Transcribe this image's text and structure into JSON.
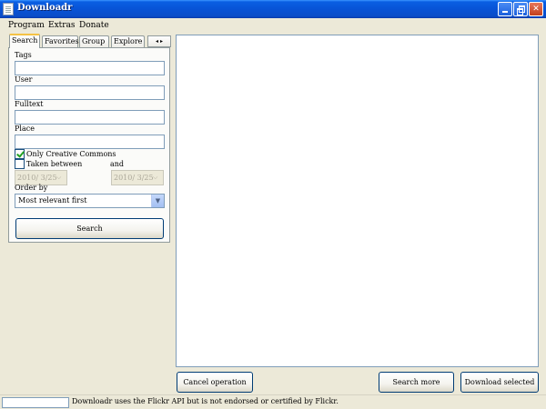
{
  "window": {
    "title": "Downloadr",
    "icon": "document-icon"
  },
  "menu": [
    "Program",
    "Extras",
    "Donate"
  ],
  "tabs": {
    "items": [
      "Search",
      "Favorites",
      "Group",
      "Explore"
    ],
    "active": "Search",
    "scroll_left": "◂",
    "scroll_right": "▸"
  },
  "search_form": {
    "tags_label": "Tags",
    "tags_value": "",
    "user_label": "User",
    "user_value": "",
    "fulltext_label": "Fulltext",
    "fulltext_value": "",
    "place_label": "Place",
    "place_value": "",
    "creative_commons_label": "Only Creative Commons",
    "creative_commons_checked": true,
    "taken_between_label": "Taken between",
    "taken_between_checked": false,
    "and_label": "and",
    "date_from": "2010/ 3/25",
    "date_to": "2010/ 3/25",
    "order_by_label": "Order by",
    "order_by_value": "Most relevant first",
    "search_button": "Search"
  },
  "actions": {
    "cancel": "Cancel operation",
    "search_more": "Search more",
    "download_selected": "Download selected"
  },
  "status": {
    "text": "Downloadr uses the Flickr API but is not endorsed or certified by Flickr."
  }
}
